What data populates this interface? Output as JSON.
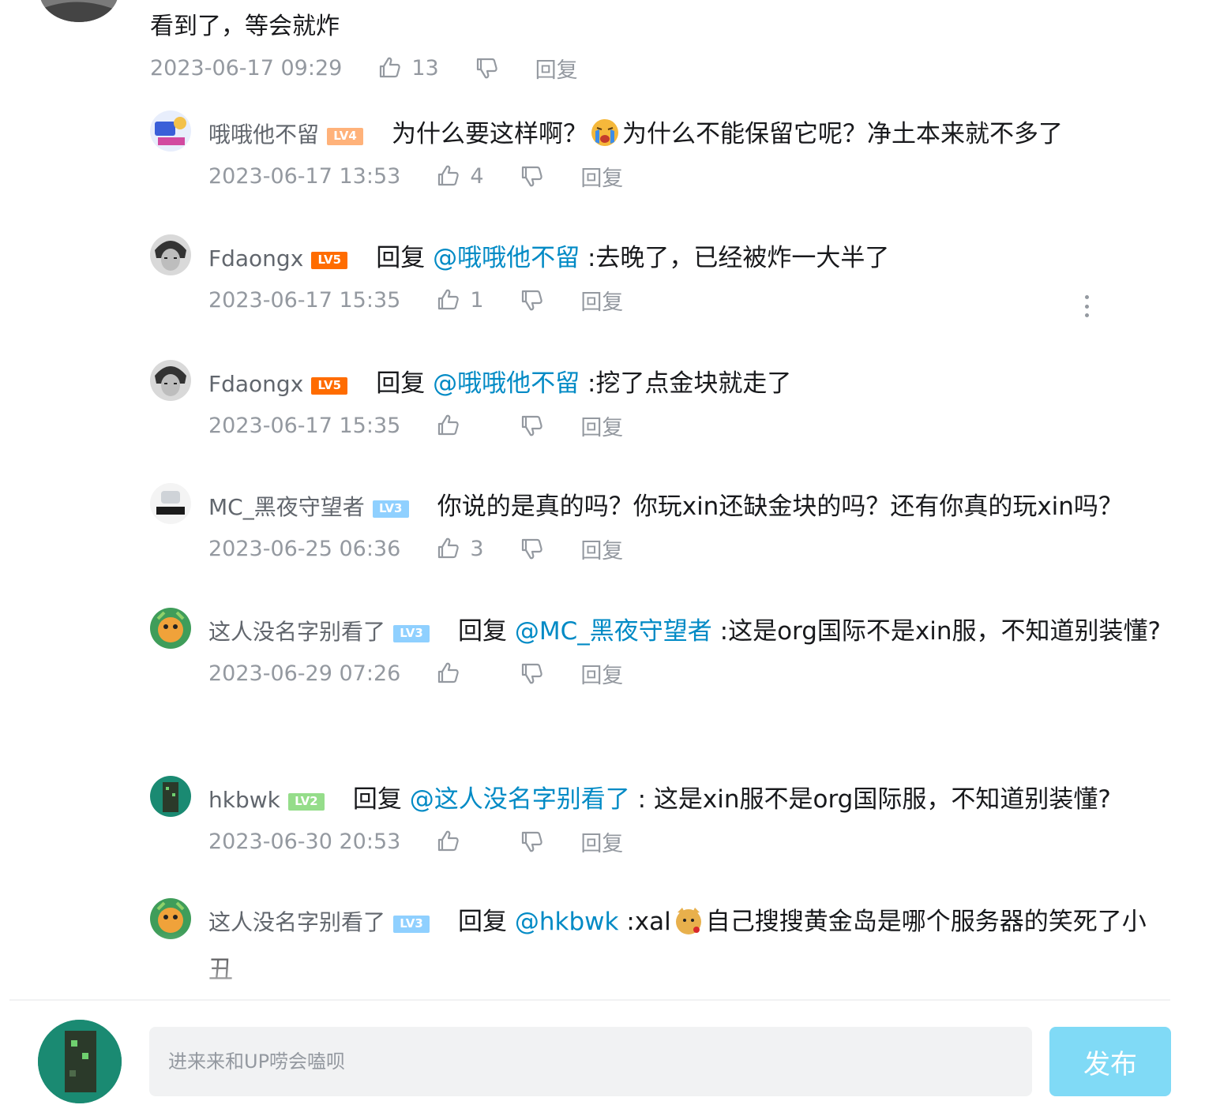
{
  "root_comment": {
    "text": "看到了，等会就炸",
    "time": "2023-06-17 09:29",
    "likes": "13",
    "reply_label": "回复"
  },
  "replies": [
    {
      "user": "哦哦他不留",
      "level": "LV4",
      "prefix": "",
      "mention": "",
      "text_before_emoji": "为什么要这样啊？",
      "text": "为什么不能保留它呢？净土本来就不多了",
      "emoji": "crying-emoji",
      "time": "2023-06-17 13:53",
      "likes": "4",
      "reply_label": "回复"
    },
    {
      "user": "Fdaongx",
      "level": "LV5",
      "prefix": "回复",
      "mention": "@哦哦他不留",
      "text": " :去晚了，已经被炸一大半了",
      "time": "2023-06-17 15:35",
      "likes": "1",
      "reply_label": "回复"
    },
    {
      "user": "Fdaongx",
      "level": "LV5",
      "prefix": "回复",
      "mention": "@哦哦他不留",
      "text": " :挖了点金块就走了",
      "time": "2023-06-17 15:35",
      "likes": "",
      "reply_label": "回复"
    },
    {
      "user": "MC_黑夜守望者",
      "level": "LV3",
      "prefix": "",
      "mention": "",
      "text": "你说的是真的吗？你玩xin还缺金块的吗？还有你真的玩xin吗？",
      "time": "2023-06-25 06:36",
      "likes": "3",
      "reply_label": "回复"
    },
    {
      "user": "这人没名字别看了",
      "level": "LV3",
      "prefix": "回复",
      "mention": "@MC_黑夜守望者",
      "text": " :这是org国际不是xin服，不知道别装懂?",
      "time": "2023-06-29 07:26",
      "likes": "",
      "reply_label": "回复"
    },
    {
      "user": "hkbwk",
      "level": "LV2",
      "prefix": "回复",
      "mention": "@这人没名字别看了",
      "text": " : 这是xin服不是org国际服，不知道别装懂?",
      "time": "2023-06-30 20:53",
      "likes": "",
      "reply_label": "回复"
    },
    {
      "user": "这人没名字别看了",
      "level": "LV3",
      "prefix": "回复",
      "mention": "@hkbwk",
      "text_before_emoji": " :xal",
      "text": "自己搜搜黄金岛是哪个服务器的笑死了小丑",
      "emoji": "doge-rose-emoji"
    }
  ],
  "composer": {
    "placeholder": "进来来和UP唠会嗑呗",
    "send_label": "发布"
  },
  "colors": {
    "mention": "#008ac5",
    "meta": "#9499a0",
    "send_button": "#80daf6",
    "lv2": "#95dd8a",
    "lv3": "#8fd0ff",
    "lv4": "#ffb27a",
    "lv5": "#ff6c00"
  }
}
